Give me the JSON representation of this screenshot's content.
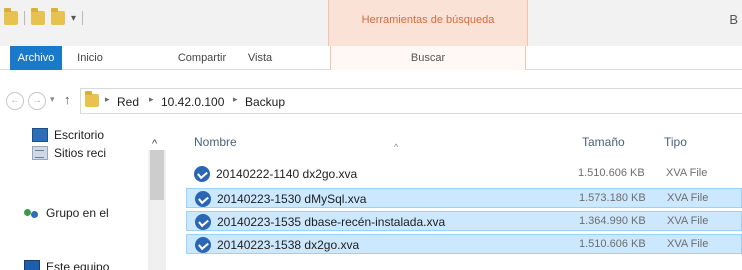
{
  "titlebar": {
    "contextual_tab_label": "Herramientas de búsqueda",
    "title_fragment": "B"
  },
  "ribbon": {
    "tabs": [
      {
        "label": "Archivo"
      },
      {
        "label": "Inicio"
      },
      {
        "label": "Compartir"
      },
      {
        "label": "Vista"
      },
      {
        "label": "Buscar"
      }
    ]
  },
  "address": {
    "crumbs": [
      "Red",
      "10.42.0.100",
      "Backup"
    ]
  },
  "navigation": {
    "items": [
      {
        "label": "Escritorio",
        "icon": "desktop-icon"
      },
      {
        "label": "Sitios reci",
        "icon": "recent-sites-icon"
      },
      {
        "label": "Grupo en el",
        "icon": "homegroup-icon"
      },
      {
        "label": "Este equipo",
        "icon": "computer-icon"
      }
    ]
  },
  "columns": {
    "name": "Nombre",
    "size": "Tamaño",
    "type": "Tipo"
  },
  "files": [
    {
      "name": "20140222-1140 dx2go.xva",
      "size": "1.510.606 KB",
      "type": "XVA File",
      "selected": false
    },
    {
      "name": "20140223-1530 dMySql.xva",
      "size": "1.573.180 KB",
      "type": "XVA File",
      "selected": true
    },
    {
      "name": "20140223-1535 dbase-recén-instalada.xva",
      "size": "1.364.990 KB",
      "type": "XVA File",
      "selected": true
    },
    {
      "name": "20140223-1538 dx2go.xva",
      "size": "1.510.606 KB",
      "type": "XVA File",
      "selected": true
    }
  ],
  "colors": {
    "file_tab": "#1979ca",
    "contextual_tab": "#fbe2d7",
    "selection": "#cce8ff"
  }
}
